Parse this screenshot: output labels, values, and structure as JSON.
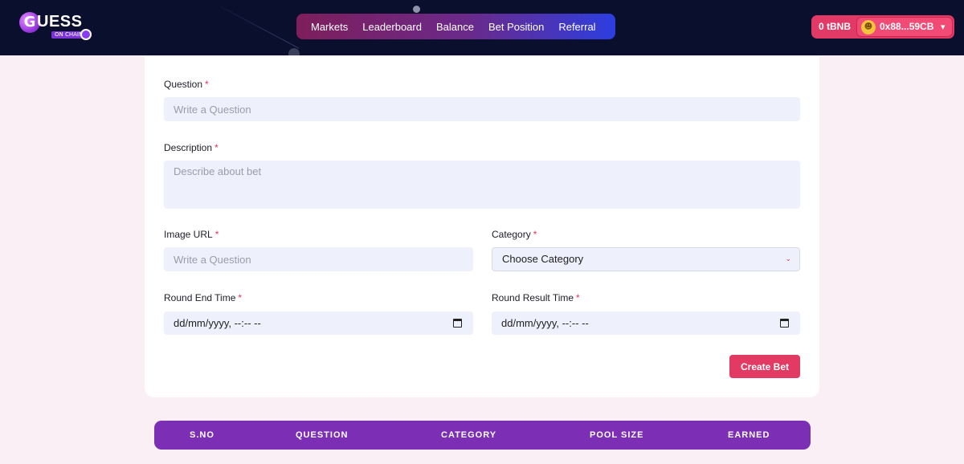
{
  "brand": {
    "logo_letter": "G",
    "logo_word": "UESS",
    "logo_sub": "ON CHAIN"
  },
  "nav": {
    "items": [
      "Markets",
      "Leaderboard",
      "Balance",
      "Bet Position",
      "Referral"
    ]
  },
  "wallet": {
    "balance": "0 tBNB",
    "address": "0x88...59CB"
  },
  "form": {
    "question": {
      "label": "Question",
      "placeholder": "Write a Question"
    },
    "description": {
      "label": "Description",
      "placeholder": "Describe about bet"
    },
    "image_url": {
      "label": "Image URL",
      "placeholder": "Write a Question"
    },
    "category": {
      "label": "Category",
      "value": "Choose Category"
    },
    "round_end": {
      "label": "Round End Time",
      "value": "dd/mm/yyyy, --:-- --"
    },
    "round_result": {
      "label": "Round Result Time",
      "value": "dd/mm/yyyy, --:-- --"
    },
    "required_mark": "*",
    "submit_label": "Create Bet"
  },
  "table": {
    "columns": [
      "S.NO",
      "QUESTION",
      "CATEGORY",
      "POOL SIZE",
      "EARNED"
    ]
  },
  "colors": {
    "header_bg": "#0b0f2e",
    "accent_pink": "#e23a62",
    "table_purple": "#7c2fb4",
    "page_bg": "#fbeff6"
  }
}
